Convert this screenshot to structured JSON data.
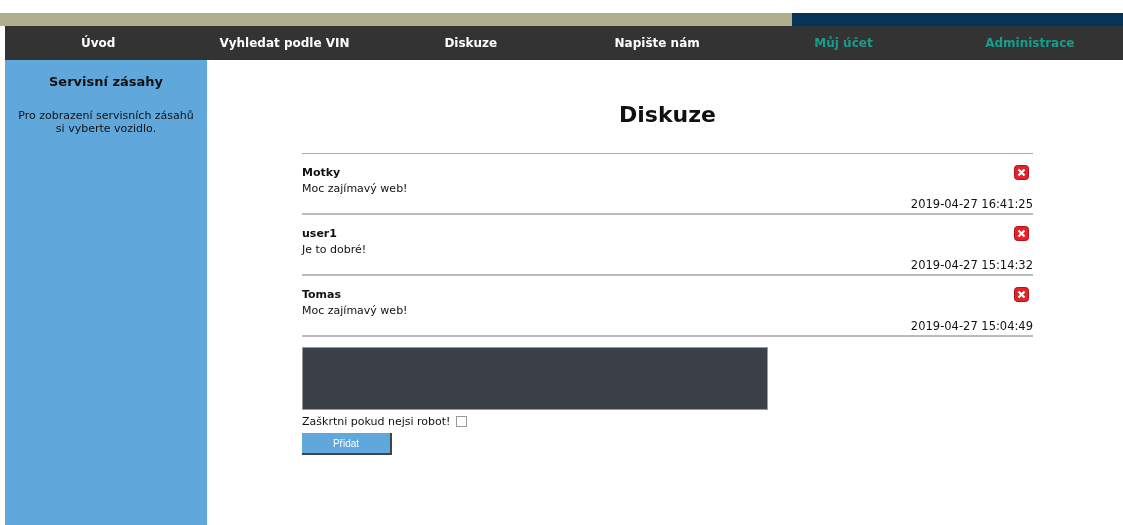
{
  "nav": [
    {
      "label": "Úvod",
      "color": "#ffffff"
    },
    {
      "label": "Vyhledat podle VIN",
      "color": "#ffffff"
    },
    {
      "label": "Diskuze",
      "color": "#ffffff"
    },
    {
      "label": "Napište nám",
      "color": "#ffffff"
    },
    {
      "label": "Můj účet",
      "color": "#1a9c8c"
    },
    {
      "label": "Administrace",
      "color": "#1a9c8c"
    }
  ],
  "sidebar": {
    "title": "Servisní zásahy",
    "text": "Pro zobrazení servisních zásahů si vyberte vozidlo."
  },
  "heading": "Diskuze",
  "comments": [
    {
      "author": "Motky",
      "text": "Moc zajímavý web!",
      "time": "2019-04-27 16:41:25"
    },
    {
      "author": "user1",
      "text": "Je to dobré!",
      "time": "2019-04-27 15:14:32"
    },
    {
      "author": "Tomas",
      "text": "Moc zajímavý web!",
      "time": "2019-04-27 15:04:49"
    }
  ],
  "form": {
    "captcha_label": "Zaškrtni pokud nejsi robot!",
    "captcha_checked": false,
    "submit": "Přidat"
  }
}
